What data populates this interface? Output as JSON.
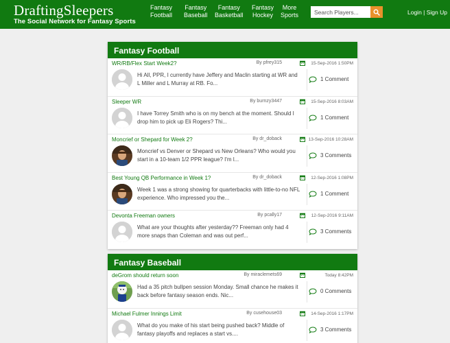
{
  "brand": {
    "name": "DraftingSleepers",
    "tagline": "The Social Network for Fantasy Sports"
  },
  "nav": [
    {
      "line1": "Fantasy",
      "line2": "Football"
    },
    {
      "line1": "Fantasy",
      "line2": "Baseball"
    },
    {
      "line1": "Fantasy",
      "line2": "Basketball"
    },
    {
      "line1": "Fantasy",
      "line2": "Hockey"
    },
    {
      "line1": "More",
      "line2": "Sports"
    }
  ],
  "search": {
    "placeholder": "Search Players..."
  },
  "auth": {
    "login": "Login",
    "sep": " | ",
    "signup": "Sign Up"
  },
  "colors": {
    "brand_green": "#117a11",
    "search_button": "#e8912b",
    "page_bg": "#efefef"
  },
  "sections": [
    {
      "title": "Fantasy Football",
      "posts": [
        {
          "title": "WR/RB/Flex Start Week2?",
          "by": "By pfrey315",
          "date": "15-Sep-2016 1:50PM",
          "text": "Hi All, PPR, I currently have Jeffery and Maclin starting at WR and L Miller and L Murray at RB. Fo...",
          "comments": "1 Comment",
          "avatar": "default"
        },
        {
          "title": "Sleeper WR",
          "by": "By burnzy3447",
          "date": "15-Sep-2016 8:03AM",
          "text": "I have Torrey Smith who is on my bench at the moment. Should I drop him to pick up Eli Rogers? Thi...",
          "comments": "1 Comment",
          "avatar": "default"
        },
        {
          "title": "Moncrief or Shepard for Week 2?",
          "by": "By dr_doback",
          "date": "13-Sep-2016 10:28AM",
          "text": "Moncrief vs Denver or Shepard vs New Orleans? Who would you start in a 10-team 1/2 PPR league? I'm l...",
          "comments": "3 Comments",
          "avatar": "photo"
        },
        {
          "title": "Best Young QB Performance in Week 1?",
          "by": "By dr_doback",
          "date": "12-Sep-2016 1:08PM",
          "text": "Week 1 was a strong showing for quarterbacks with little-to-no NFL experience. Who impressed you the...",
          "comments": "1 Comment",
          "avatar": "photo"
        },
        {
          "title": "Devonta Freeman owners",
          "by": "By pcally17",
          "date": "12-Sep-2016 9:11AM",
          "text": "What are your thoughts after yesterday?? Freeman only had 4 more snaps than Coleman and was out perf...",
          "comments": "3 Comments",
          "avatar": "default"
        }
      ]
    },
    {
      "title": "Fantasy Baseball",
      "posts": [
        {
          "title": "deGrom should return soon",
          "by": "By miraclemets69",
          "date": "Today 8:42PM",
          "text": "Had a 35 pitch bullpen session Monday. Small chance he makes it back before fantasy season ends. Nic...",
          "comments": "0 Comments",
          "avatar": "mets"
        },
        {
          "title": "Michael Fulmer Innings Limit",
          "by": "By cusehouse03",
          "date": "14-Sep-2016 1:17PM",
          "text": "What do you make of his start being pushed back? Middle of fantasy playoffs and replaces a start vs....",
          "comments": "3 Comments",
          "avatar": "default"
        }
      ]
    }
  ]
}
